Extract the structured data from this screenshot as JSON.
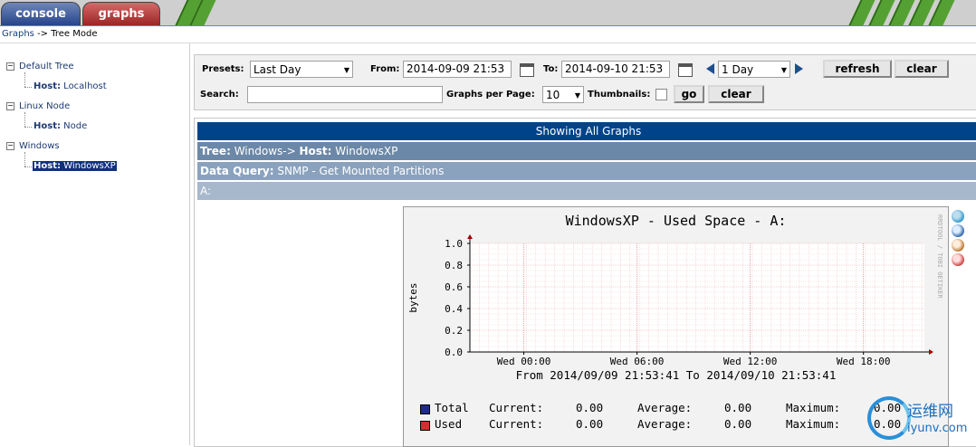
{
  "tabs": {
    "console": "console",
    "graphs": "graphs"
  },
  "breadcrumb": {
    "link": "Graphs",
    "sep": " -> ",
    "current": "Tree Mode"
  },
  "tree": {
    "nodes": [
      {
        "label": "Default Tree",
        "host_prefix": "Host:",
        "host": "Localhost"
      },
      {
        "label": "Linux Node",
        "host_prefix": "Host:",
        "host": "Node"
      },
      {
        "label": "Windows",
        "host_prefix": "Host:",
        "host": "WindowsXP"
      }
    ]
  },
  "filter": {
    "presets_label": "Presets:",
    "presets_value": "Last Day",
    "from_label": "From:",
    "from_value": "2014-09-09 21:53",
    "to_label": "To:",
    "to_value": "2014-09-10 21:53",
    "span_value": "1 Day",
    "refresh": "refresh",
    "clear": "clear",
    "search_label": "Search:",
    "search_value": "",
    "gpp_label": "Graphs per Page:",
    "gpp_value": "10",
    "thumbs_label": "Thumbnails:",
    "go": "go",
    "clear2": "clear"
  },
  "headers": {
    "showing": "Showing All Graphs",
    "tree_label": "Tree:",
    "tree_value": "Windows->",
    "host_label": "Host:",
    "host_value": "WindowsXP",
    "dq_label": "Data Query:",
    "dq_value": "SNMP - Get Mounted Partitions",
    "partition": "A:"
  },
  "graph": {
    "side_text": "RRDTOOL / TOBI OETIKER",
    "footer_from": "From 2014/09/09 21:53:41 To 2014/09/10 21:53:41",
    "legend": [
      {
        "name": "Total",
        "color": "#1f2b8c",
        "current_label": "Current:",
        "current": "0.00",
        "average_label": "Average:",
        "average": "0.00",
        "maximum_label": "Maximum:",
        "maximum": "0.00"
      },
      {
        "name": "Used",
        "color": "#d03030",
        "current_label": "Current:",
        "current": "0.00",
        "average_label": "Average:",
        "average": "0.00",
        "maximum_label": "Maximum:",
        "maximum": "0.00"
      }
    ]
  },
  "chart_data": {
    "type": "line",
    "title": "WindowsXP - Used Space - A:",
    "ylabel": "bytes",
    "xlabel": "",
    "ylim": [
      0,
      1.0
    ],
    "yticks": [
      "0.0",
      "0.2",
      "0.4",
      "0.6",
      "0.8",
      "1.0"
    ],
    "xticks": [
      "Wed 00:00",
      "Wed 06:00",
      "Wed 12:00",
      "Wed 18:00"
    ],
    "grid": true,
    "series": [
      {
        "name": "Total",
        "color": "#1f2b8c",
        "values": []
      },
      {
        "name": "Used",
        "color": "#d03030",
        "values": []
      }
    ]
  },
  "watermark": {
    "cn": "运维网",
    "url": "iyunv.com"
  }
}
